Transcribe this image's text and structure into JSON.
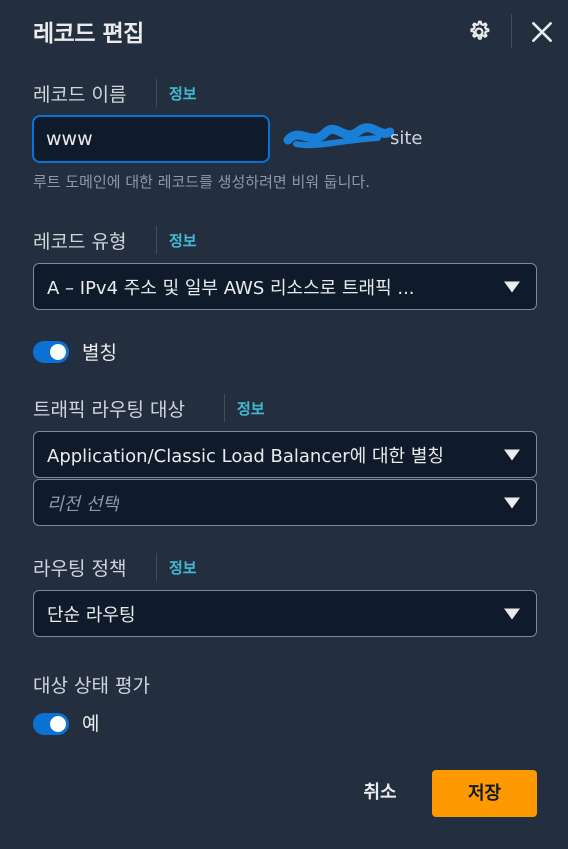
{
  "header": {
    "title": "레코드 편집",
    "settings_icon": "gear-icon",
    "close_icon": "close-icon"
  },
  "record_name": {
    "label": "레코드 이름",
    "info": "정보",
    "value": "www",
    "domain_suffix": "site",
    "description": "루트 도메인에 대한 레코드를 생성하려면 비워 둡니다."
  },
  "record_type": {
    "label": "레코드 유형",
    "info": "정보",
    "selected": "A – IPv4 주소 및 일부 AWS 리소스로 트래픽 ..."
  },
  "alias": {
    "label": "별칭",
    "enabled": true
  },
  "traffic_target": {
    "label": "트래픽 라우팅 대상",
    "info": "정보",
    "selected": "Application/Classic Load Balancer에 대한 별칭",
    "region_placeholder": "리전 선택"
  },
  "routing_policy": {
    "label": "라우팅 정책",
    "info": "정보",
    "selected": "단순 라우팅"
  },
  "health_eval": {
    "label": "대상 상태 평가",
    "toggle_label": "예",
    "enabled": true
  },
  "footer": {
    "cancel_label": "취소",
    "save_label": "저장"
  },
  "colors": {
    "accent": "#0972d3",
    "link": "#44b9d6",
    "primary_button": "#ff9900",
    "background": "#232f3e"
  }
}
